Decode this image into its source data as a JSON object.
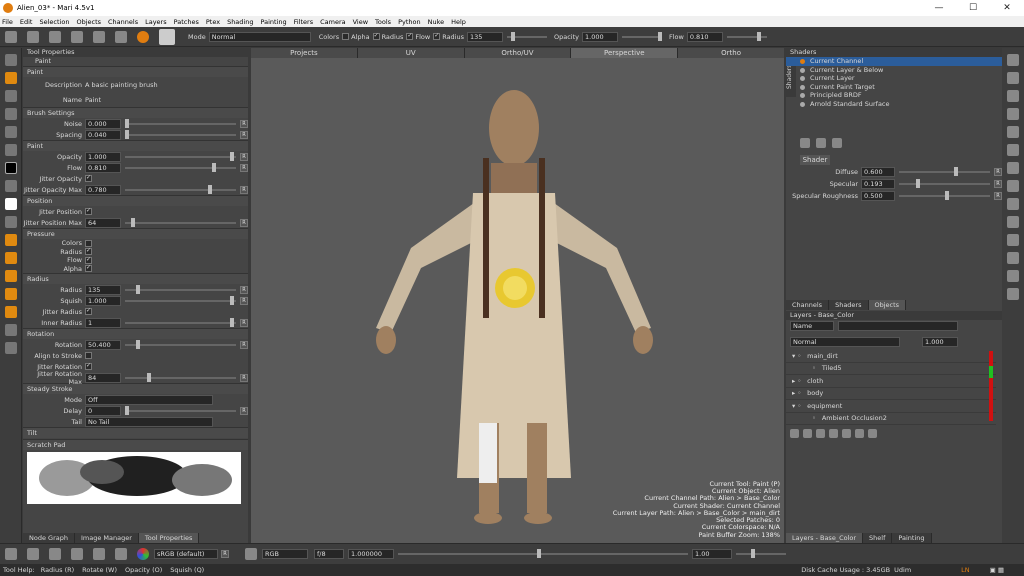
{
  "window": {
    "title": "Alien_03* - Mari 4.5v1",
    "minimize": "—",
    "maximize": "☐",
    "close": "✕"
  },
  "menu": [
    "File",
    "Edit",
    "Selection",
    "Objects",
    "Channels",
    "Layers",
    "Patches",
    "Ptex",
    "Shading",
    "Painting",
    "Filters",
    "Camera",
    "View",
    "Tools",
    "Python",
    "Nuke",
    "Help"
  ],
  "toolbar": {
    "mode_label": "Mode",
    "mode_value": "Normal",
    "colors_label": "Colors",
    "alpha_label": "Alpha",
    "radius_label": "Radius",
    "flow_label": "Flow",
    "radius2_label": "Radius",
    "radius_value": "135",
    "opacity_label": "Opacity",
    "opacity_value": "1.000",
    "flow2_label": "Flow",
    "flow_value": "0.810"
  },
  "tool_properties": {
    "header": "Tool Properties",
    "paint_tab": "Paint",
    "paint_section": "Paint",
    "description_label": "Description",
    "description_value": "A basic painting brush",
    "name_label": "Name",
    "name_value": "Paint",
    "brush_settings": "Brush Settings",
    "noise_label": "Noise",
    "noise_value": "0.000",
    "spacing_label": "Spacing",
    "spacing_value": "0.040",
    "paint2": "Paint",
    "opacity_label": "Opacity",
    "opacity_value": "1.000",
    "flow_label": "Flow",
    "flow_value": "0.810",
    "jitter_opacity_label": "Jitter Opacity",
    "jitter_opacity_max_label": "Jitter Opacity Max",
    "jitter_opacity_max_value": "0.780",
    "position": "Position",
    "jitter_position_label": "Jitter Position",
    "jitter_position_max_label": "Jitter Position Max",
    "jitter_position_max_value": "64",
    "pressure": "Pressure",
    "p_colors": "Colors",
    "p_radius": "Radius",
    "p_flow": "Flow",
    "p_alpha": "Alpha",
    "radius_section": "Radius",
    "radius_label": "Radius",
    "radius_value": "135",
    "squish_label": "Squish",
    "squish_value": "1.000",
    "jitter_radius_label": "Jitter Radius",
    "inner_radius_label": "Inner Radius",
    "inner_radius_value": "1",
    "rotation_section": "Rotation",
    "rotation_label": "Rotation",
    "rotation_value": "50.400",
    "align_label": "Align to Stroke",
    "jitter_rotation_label": "Jitter Rotation",
    "jitter_rotation_max_label": "Jitter Rotation Max",
    "jitter_rotation_max_value": "84",
    "steady_section": "Steady Stroke",
    "mode_label": "Mode",
    "mode_value": "Off",
    "delay_label": "Delay",
    "delay_value": "0",
    "tail_label": "Tail",
    "tail_value": "No Tail",
    "tilt_section": "Tilt",
    "scratch_pad": "Scratch Pad",
    "tabs": [
      "Node Graph",
      "Image Manager",
      "Tool Properties"
    ]
  },
  "viewport_tabs": [
    "Projects",
    "UV",
    "Ortho/UV",
    "Perspective",
    "Ortho"
  ],
  "viewport_info": [
    "Current Tool: Paint (P)",
    "Current Object: Alien",
    "Current Channel Path: Alien > Base_Color",
    "Current Shader: Current Channel",
    "Current Layer Path: Alien > Base_Color > main_dirt",
    "Selected Patches: 0",
    "Current Colorspace: N/A",
    "Paint Buffer Zoom: 138%"
  ],
  "shaders": {
    "header": "Shaders",
    "side_tab": "Shaders",
    "items": [
      "Current Channel",
      "Current Layer & Below",
      "Current Layer",
      "Current Paint Target",
      "Principled BRDF",
      "Arnold Standard Surface"
    ],
    "shader_tab": "Shader",
    "diffuse_label": "Diffuse",
    "diffuse_value": "0.600",
    "specular_label": "Specular",
    "specular_value": "0.193",
    "roughness_label": "Specular Roughness",
    "roughness_value": "0.500"
  },
  "mid_tabs": [
    "Channels",
    "Shaders",
    "Objects"
  ],
  "layers": {
    "header": "Layers - Base_Color",
    "filter_label": "Name",
    "blend_mode": "Normal",
    "opacity": "1.000",
    "items": [
      "main_dirt",
      "Tiled5",
      "cloth",
      "body",
      "equipment",
      "Ambient Occlusion2"
    ]
  },
  "right_bottom_tabs": [
    "Layers - Base_Color",
    "Shelf",
    "Painting"
  ],
  "bottombar": {
    "colorspace": "sRGB (default)",
    "channel": "RGB",
    "fstop": "f/8",
    "exposure": "1.000000",
    "gamma": "1.00"
  },
  "status": {
    "help": "Tool Help:",
    "hints": [
      "Radius (R)",
      "Rotate (W)",
      "Opacity (O)",
      "Squish (Q)"
    ],
    "disk_cache": "Disk Cache Usage : 3.45GB",
    "udim": "Udim",
    "ln": "LN",
    "colors": {
      "accent": "#e07d10",
      "selection": "#2b5d9b",
      "red_strip": "#d01010",
      "green_strip": "#20c020"
    }
  }
}
